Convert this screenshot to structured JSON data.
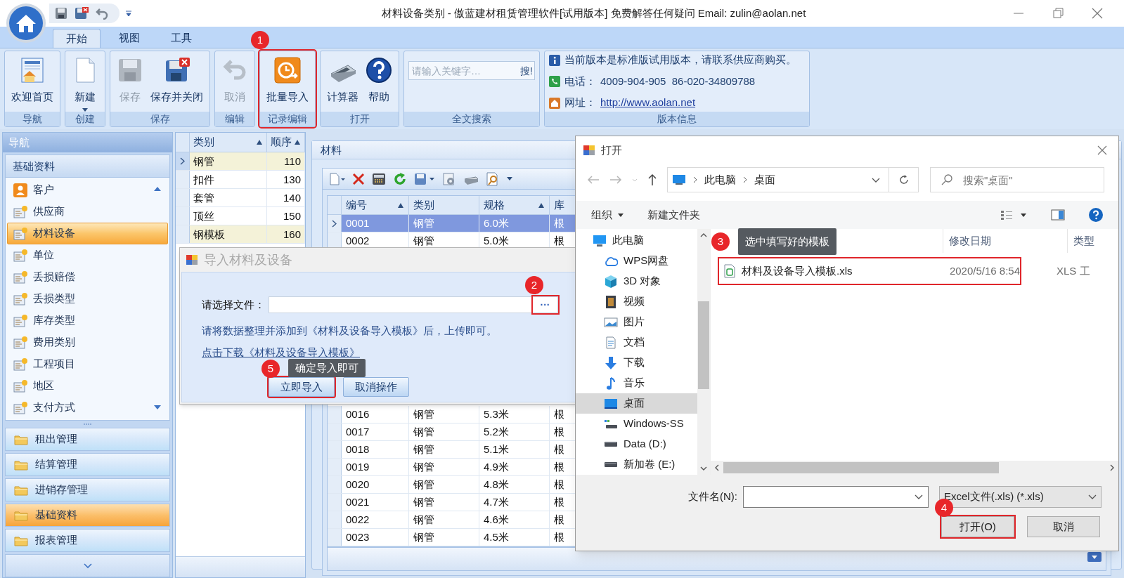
{
  "window": {
    "title": "材料设备类别 - 傲蓝建材租赁管理软件[试用版本] 免费解答任何疑问 Email: zulin@aolan.net"
  },
  "ribbon": {
    "tabs": [
      {
        "label": "开始",
        "selected": true
      },
      {
        "label": "视图",
        "selected": false
      },
      {
        "label": "工具",
        "selected": false
      }
    ],
    "groups": [
      {
        "kind": "buttons",
        "label": "导航",
        "outlined": false,
        "buttons": [
          {
            "label": "欢迎首页",
            "disabled": false,
            "dropdown": false
          }
        ]
      },
      {
        "kind": "buttons",
        "label": "创建",
        "outlined": false,
        "buttons": [
          {
            "label": "新建",
            "disabled": false,
            "dropdown": true
          }
        ]
      },
      {
        "kind": "buttons",
        "label": "保存",
        "outlined": false,
        "buttons": [
          {
            "label": "保存",
            "disabled": true,
            "dropdown": false
          },
          {
            "label": "保存并关闭",
            "disabled": false,
            "dropdown": false
          }
        ]
      },
      {
        "kind": "buttons",
        "label": "编辑",
        "outlined": false,
        "buttons": [
          {
            "label": "取消",
            "disabled": true,
            "dropdown": false
          }
        ]
      },
      {
        "kind": "buttons",
        "label": "记录编辑",
        "outlined": true,
        "marker": "1",
        "buttons": [
          {
            "label": "批量导入",
            "disabled": false,
            "dropdown": false
          }
        ]
      },
      {
        "kind": "buttons",
        "label": "打开",
        "outlined": false,
        "buttons": [
          {
            "label": "计算器",
            "disabled": false,
            "dropdown": false
          },
          {
            "label": "帮助",
            "disabled": false,
            "dropdown": false
          }
        ]
      },
      {
        "kind": "search",
        "label": "全文搜索",
        "outlined": false,
        "placeholder": "请输入关键字…",
        "button": "搜!"
      },
      {
        "kind": "info",
        "label": "版本信息",
        "outlined": false,
        "lines": [
          {
            "kind": "text",
            "text": "当前版本是标准版试用版本，请联系供应商购买。"
          },
          {
            "kind": "phone",
            "label": "电话：",
            "value": "4009-904-905  86-020-34809788"
          },
          {
            "kind": "link",
            "label": "网址：",
            "value": "http://www.aolan.net"
          }
        ]
      }
    ]
  },
  "nav": {
    "title": "导航",
    "group": "基础资料",
    "items": [
      {
        "label": "客户",
        "selected": false
      },
      {
        "label": "供应商",
        "selected": false
      },
      {
        "label": "材料设备",
        "selected": true
      },
      {
        "label": "单位",
        "selected": false
      },
      {
        "label": "丢损赔偿",
        "selected": false
      },
      {
        "label": "丢损类型",
        "selected": false
      },
      {
        "label": "库存类型",
        "selected": false
      },
      {
        "label": "费用类别",
        "selected": false
      },
      {
        "label": "工程项目",
        "selected": false
      },
      {
        "label": "地区",
        "selected": false
      },
      {
        "label": "支付方式",
        "selected": false
      }
    ],
    "sections": [
      {
        "label": "租出管理",
        "selected": false
      },
      {
        "label": "结算管理",
        "selected": false
      },
      {
        "label": "进销存管理",
        "selected": false
      },
      {
        "label": "基础资料",
        "selected": true
      },
      {
        "label": "报表管理",
        "selected": false
      }
    ]
  },
  "category_grid": {
    "columns": [
      {
        "label": "类别",
        "sorted": true
      },
      {
        "label": "顺序",
        "sorted": true
      }
    ],
    "rows": [
      {
        "cells": [
          "钢管",
          "110"
        ],
        "current": true,
        "highlighted": true
      },
      {
        "cells": [
          "扣件",
          "130"
        ],
        "current": false,
        "highlighted": false
      },
      {
        "cells": [
          "套管",
          "140"
        ],
        "current": false,
        "highlighted": false
      },
      {
        "cells": [
          "顶丝",
          "150"
        ],
        "current": false,
        "highlighted": false
      },
      {
        "cells": [
          "钢模板",
          "160"
        ],
        "current": false,
        "highlighted": true
      }
    ]
  },
  "materials": {
    "title": "材料",
    "columns": [
      {
        "label": "编号",
        "sorted": true
      },
      {
        "label": "类别",
        "sorted": false
      },
      {
        "label": "规格",
        "sorted": true
      },
      {
        "label": "库"
      }
    ],
    "rows_top": [
      {
        "cells": [
          "0001",
          "钢管",
          "6.0米",
          "根"
        ],
        "selected": true
      },
      {
        "cells": [
          "0002",
          "钢管",
          "5.0米",
          "根"
        ],
        "selected": false
      }
    ],
    "rows_bottom": [
      {
        "cells": [
          "0016",
          "钢管",
          "5.3米",
          "根"
        ],
        "selected": false
      },
      {
        "cells": [
          "0017",
          "钢管",
          "5.2米",
          "根"
        ],
        "selected": false
      },
      {
        "cells": [
          "0018",
          "钢管",
          "5.1米",
          "根"
        ],
        "selected": false
      },
      {
        "cells": [
          "0019",
          "钢管",
          "4.9米",
          "根"
        ],
        "selected": false
      },
      {
        "cells": [
          "0020",
          "钢管",
          "4.8米",
          "根"
        ],
        "selected": false
      },
      {
        "cells": [
          "0021",
          "钢管",
          "4.7米",
          "根"
        ],
        "selected": false
      },
      {
        "cells": [
          "0022",
          "钢管",
          "4.6米",
          "根"
        ],
        "selected": false
      },
      {
        "cells": [
          "0023",
          "钢管",
          "4.5米",
          "根"
        ],
        "selected": false
      }
    ]
  },
  "import_dialog": {
    "title": "导入材料及设备",
    "file_label": "请选择文件：",
    "browse": {
      "label": "···",
      "outlined": true,
      "marker": "2"
    },
    "hint": "请将数据整理并添加到《材料及设备导入模板》后，上传即可。",
    "link": "点击下载《材料及设备导入模板》",
    "buttons": [
      {
        "label": "立即导入",
        "outlined": true,
        "marker": "5",
        "tooltip": "确定导入即可"
      },
      {
        "label": "取消操作",
        "outlined": false
      }
    ]
  },
  "open_dialog": {
    "title": "打开",
    "path": [
      "此电脑",
      "桌面"
    ],
    "search_placeholder": "搜索\"桌面\"",
    "organize": "组织",
    "new_folder": "新建文件夹",
    "tree": [
      {
        "label": "此电脑",
        "selected": false
      },
      {
        "label": "WPS网盘",
        "selected": false
      },
      {
        "label": "3D 对象",
        "selected": false
      },
      {
        "label": "视频",
        "selected": false
      },
      {
        "label": "图片",
        "selected": false
      },
      {
        "label": "文档",
        "selected": false
      },
      {
        "label": "下载",
        "selected": false
      },
      {
        "label": "音乐",
        "selected": false
      },
      {
        "label": "桌面",
        "selected": true
      },
      {
        "label": "Windows-SS",
        "selected": false
      },
      {
        "label": "Data (D:)",
        "selected": false
      },
      {
        "label": "新加卷 (E:)",
        "selected": false
      }
    ],
    "columns": [
      "修改日期",
      "类型"
    ],
    "files": [
      {
        "name": "材料及设备导入模板.xls",
        "modified": "2020/5/16 8:54",
        "type": "XLS 工",
        "outlined": true,
        "marker": "3",
        "tooltip": "选中填写好的模板"
      }
    ],
    "filename_label": "文件名(N):",
    "filter": "Excel文件(.xls) (*.xls)",
    "buttons": [
      {
        "label": "打开(O)",
        "outlined": true,
        "marker": "4"
      },
      {
        "label": "取消",
        "outlined": false
      }
    ]
  }
}
